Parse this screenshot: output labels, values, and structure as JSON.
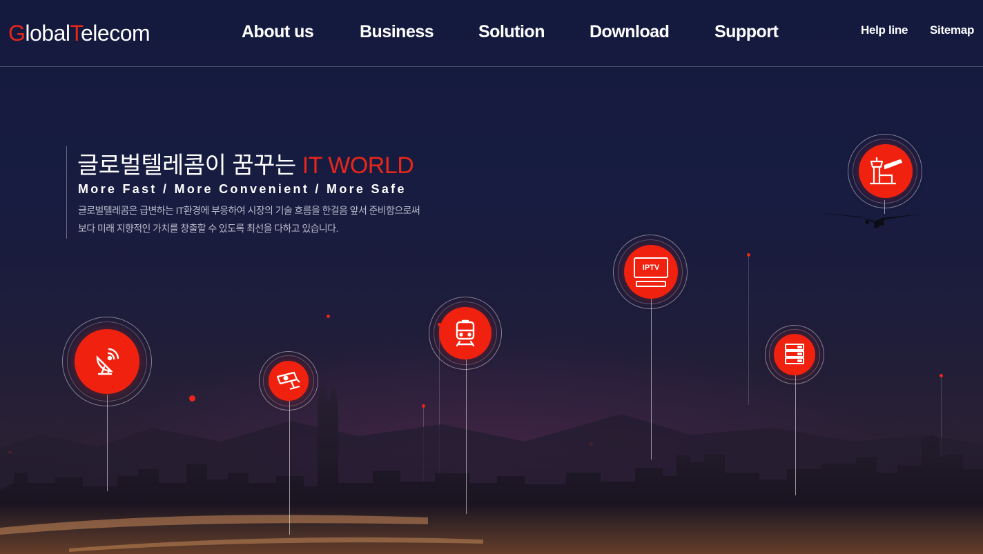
{
  "header": {
    "logo": {
      "g": "G",
      "lobal": "lobal",
      "t": "T",
      "elecom": "elecom"
    },
    "nav": [
      {
        "label": "About us"
      },
      {
        "label": "Business"
      },
      {
        "label": "Solution"
      },
      {
        "label": "Download"
      },
      {
        "label": "Support"
      }
    ],
    "utility": [
      {
        "label": "Help line"
      },
      {
        "label": "Sitemap"
      }
    ]
  },
  "hero": {
    "title_main": "글로벌텔레콤이 꿈꾸는 ",
    "title_accent": "IT WORLD",
    "subtitle": "More Fast / More Convenient / More Safe",
    "description_line1": "글로벌텔레콤은 급변하는 IT환경에 부응하여 시장의 기술 흐름을 한걸음 앞서 준비함으로써",
    "description_line2": "보다 미래 지향적인 가치를 창출할 수 있도록 최선을 다하고 있습니다."
  },
  "services": [
    {
      "icon": "satellite-dish-icon"
    },
    {
      "icon": "cctv-camera-icon"
    },
    {
      "icon": "train-icon"
    },
    {
      "icon": "iptv-icon",
      "label": "IPTV"
    },
    {
      "icon": "server-rack-icon"
    },
    {
      "icon": "airport-tower-icon"
    }
  ],
  "colors": {
    "accent": "#e8261a",
    "background": "#16193a",
    "text": "#ffffff"
  }
}
